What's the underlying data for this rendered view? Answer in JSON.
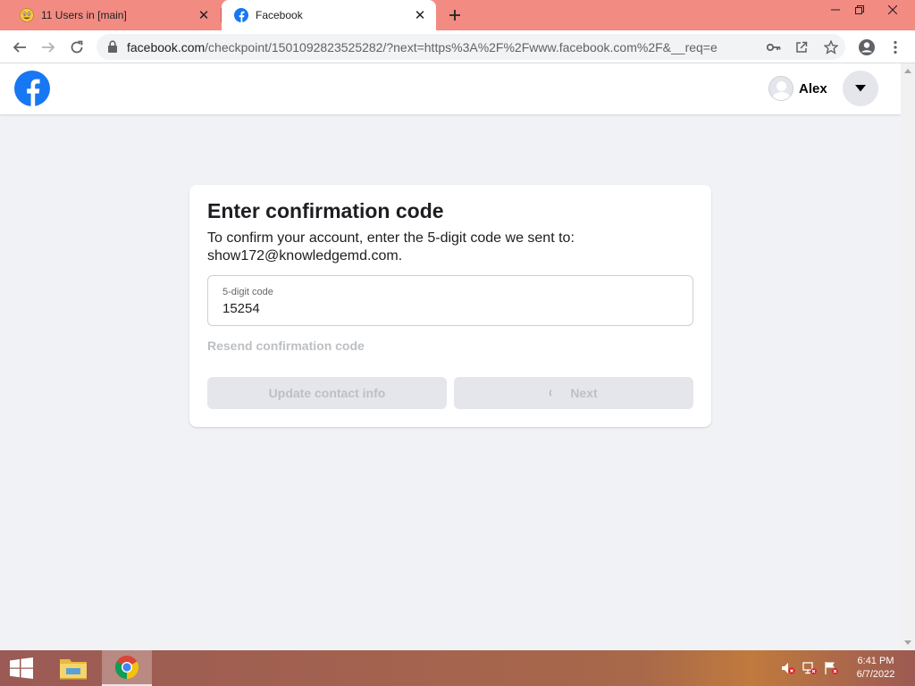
{
  "browser": {
    "tabs": [
      {
        "title": "11 Users in [main]",
        "active": false,
        "icon": "emoji-icon"
      },
      {
        "title": "Facebook",
        "active": true,
        "icon": "facebook-icon"
      }
    ],
    "url": {
      "host": "facebook.com",
      "path": "/checkpoint/1501092823525282/?next=https%3A%2F%2Fwww.facebook.com%2F&__req=e"
    },
    "tab_colors": {
      "strip": "#f28b82",
      "active": "#ffffff"
    }
  },
  "fb_header": {
    "profile_name": "Alex"
  },
  "card": {
    "title": "Enter confirmation code",
    "description": "To confirm your account, enter the 5-digit code we sent to: show172@knowledgemd.com.",
    "field_label": "5-digit code",
    "field_value": "15254",
    "resend_label": "Resend confirmation code",
    "update_label": "Update contact info",
    "next_label": "Next"
  },
  "taskbar": {
    "time": "6:41 PM",
    "date": "6/7/2022"
  },
  "colors": {
    "facebook_blue": "#1877f2",
    "page_bg": "#f0f2f5",
    "disabled_text": "#bcc0c4"
  }
}
